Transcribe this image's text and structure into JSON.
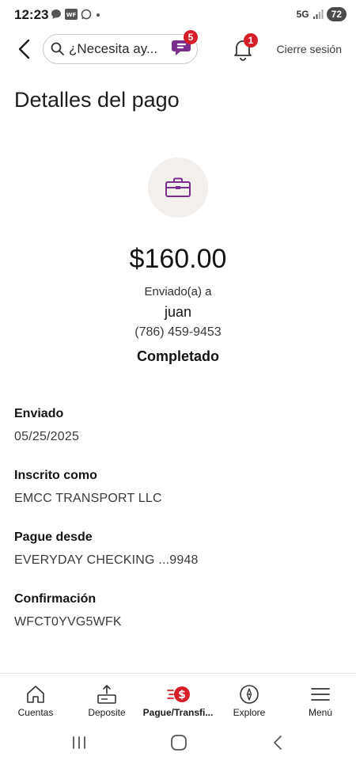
{
  "status_bar": {
    "time": "12:23",
    "network": "5G",
    "battery": "72"
  },
  "header": {
    "search_placeholder": "¿Necesita ay...",
    "fargo_badge": "5",
    "bell_badge": "1",
    "logout_label": "Cierre sesión"
  },
  "page": {
    "title": "Detalles del pago",
    "amount": "$160.00",
    "sent_to_label": "Enviado(a) a",
    "recipient_name": "juan",
    "recipient_phone": "(786) 459-9453",
    "status": "Completado"
  },
  "details": [
    {
      "label": "Enviado",
      "value": "05/25/2025"
    },
    {
      "label": "Inscrito como",
      "value": "EMCC TRANSPORT LLC"
    },
    {
      "label": "Pague desde",
      "value": "EVERYDAY CHECKING ...9948"
    },
    {
      "label": "Confirmación",
      "value": "WFCT0YVG5WFK"
    }
  ],
  "bottom_nav": {
    "items": [
      {
        "label": "Cuentas",
        "icon": "house-icon"
      },
      {
        "label": "Deposite",
        "icon": "deposit-icon"
      },
      {
        "label": "Pague/Transfi...",
        "icon": "pay-transfer-icon"
      },
      {
        "label": "Explore",
        "icon": "compass-icon"
      },
      {
        "label": "Menú",
        "icon": "menu-icon"
      }
    ],
    "active_index": 2
  },
  "colors": {
    "brand_red": "#d71e28",
    "brand_purple": "#7b2d8e",
    "circle_bg": "#f2efec"
  }
}
